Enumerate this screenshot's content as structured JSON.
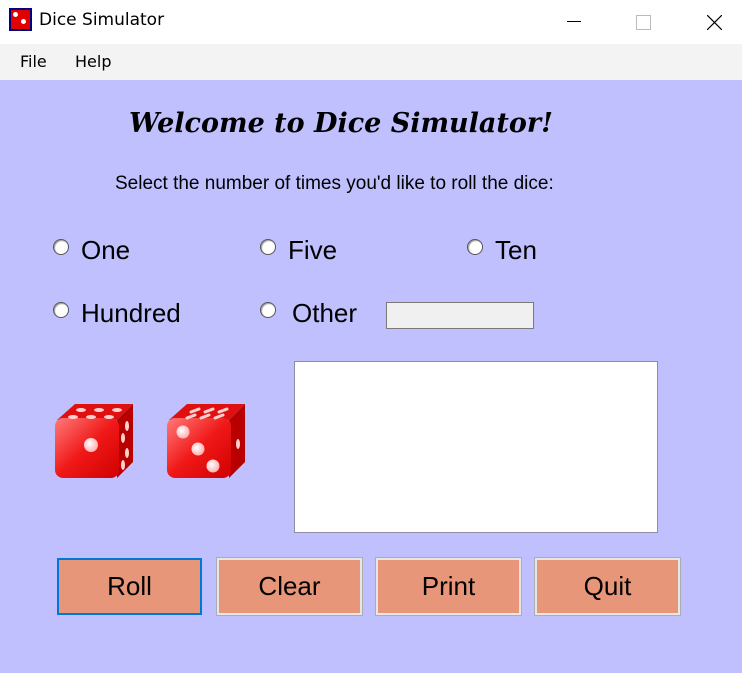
{
  "window": {
    "title": "Dice Simulator",
    "icon": "dice-app-icon",
    "controls": [
      "minimize-icon",
      "maximize-icon",
      "close-icon"
    ]
  },
  "menu": {
    "items": [
      {
        "label": "File"
      },
      {
        "label": "Help"
      }
    ]
  },
  "main": {
    "heading": "Welcome to Dice Simulator!",
    "instructions": "Select the number of times you'd like to roll the dice:",
    "roll_options": [
      {
        "label": "One",
        "selected": false
      },
      {
        "label": "Five",
        "selected": false
      },
      {
        "label": "Ten",
        "selected": false
      },
      {
        "label": "Hundred",
        "selected": false
      },
      {
        "label": "Other",
        "selected": false
      }
    ],
    "other_value": "",
    "dice": [
      {
        "face": 1
      },
      {
        "face": 3
      }
    ],
    "output_text": "",
    "buttons": [
      {
        "label": "Roll",
        "focused": true
      },
      {
        "label": "Clear",
        "focused": false
      },
      {
        "label": "Print",
        "focused": false
      },
      {
        "label": "Quit",
        "focused": false
      }
    ]
  },
  "colors": {
    "background": "#c0c0ff",
    "button": "#e8967a",
    "die": "#e00000",
    "focus": "#0078d7"
  }
}
